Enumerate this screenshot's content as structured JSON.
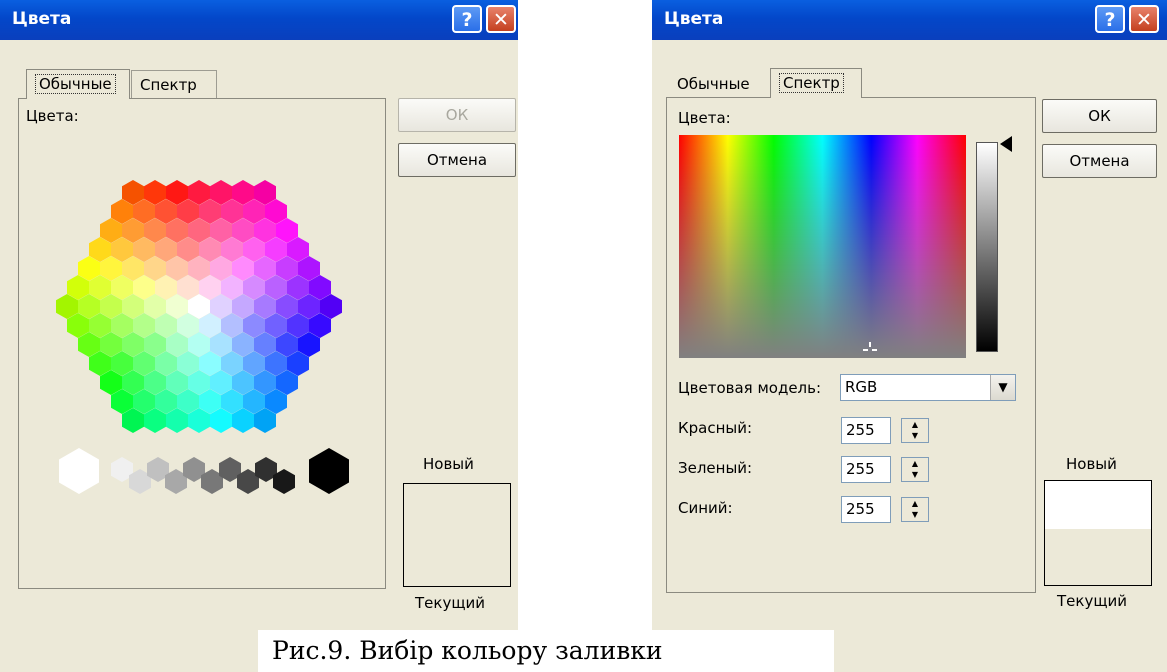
{
  "dialog_standard": {
    "title": "Цвета",
    "help_label": "?",
    "close_label": "✕",
    "tabs": [
      "Обычные",
      "Спектр"
    ],
    "colors_label": "Цвета:",
    "ok_label": "ОК",
    "cancel_label": "Отмена",
    "new_label": "Новый",
    "current_label": "Текущий"
  },
  "dialog_custom": {
    "title": "Цвета",
    "help_label": "?",
    "close_label": "✕",
    "tabs": [
      "Обычные",
      "Спектр"
    ],
    "colors_label": "Цвета:",
    "ok_label": "ОК",
    "cancel_label": "Отмена",
    "color_model_label": "Цветовая модель:",
    "color_model_value": "RGB",
    "red_label": "Красный:",
    "red_value": "255",
    "green_label": "Зеленый:",
    "green_value": "255",
    "blue_label": "Синий:",
    "blue_value": "255",
    "new_label": "Новый",
    "current_label": "Текущий",
    "new_color": "#ffffff",
    "current_color": "#ECE9D8"
  },
  "caption": "Рис.9. Вибір кольору заливки",
  "colors": {
    "titlebar": "#0347c9",
    "dialog_bg": "#ECE9D8"
  }
}
